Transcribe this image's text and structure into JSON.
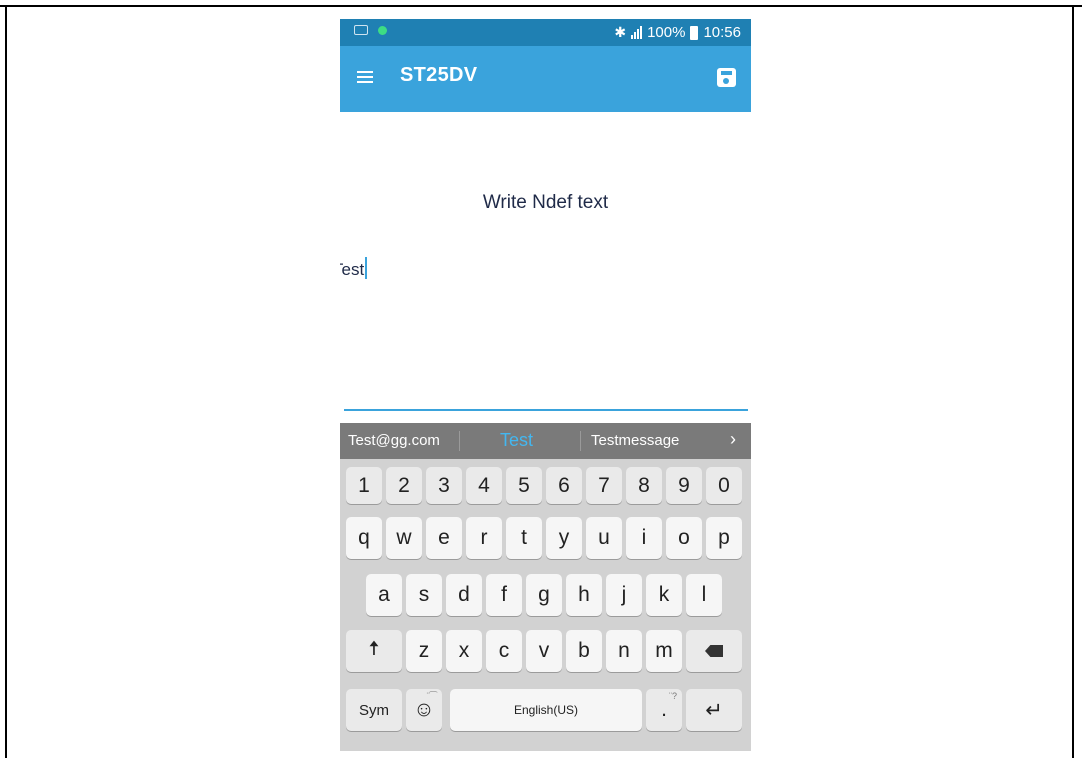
{
  "status_bar": {
    "battery": "100%",
    "time": "10:56",
    "icons": [
      "keyboard-icon",
      "dot-icon",
      "bluetooth-icon",
      "signal-icon",
      "battery-icon"
    ]
  },
  "app_bar": {
    "title": "ST25DV",
    "icons": [
      "menu-icon",
      "save-icon"
    ]
  },
  "content": {
    "heading": "Write Ndef text",
    "text_value": "Test"
  },
  "suggestions": {
    "left": "Test@gg.com",
    "middle": "Test",
    "right": "Testmessage",
    "more": "›"
  },
  "keyboard": {
    "row_numbers": [
      "1",
      "2",
      "3",
      "4",
      "5",
      "6",
      "7",
      "8",
      "9",
      "0"
    ],
    "row_1": [
      "q",
      "w",
      "e",
      "r",
      "t",
      "y",
      "u",
      "i",
      "o",
      "p"
    ],
    "row_2": [
      "a",
      "s",
      "d",
      "f",
      "g",
      "h",
      "j",
      "k",
      "l"
    ],
    "row_3": [
      "z",
      "x",
      "c",
      "v",
      "b",
      "n",
      "m"
    ],
    "sym_label": "Sym",
    "space_label": "English(US)",
    "period_label": ".",
    "period_hint": "¨?",
    "emoji_hint": "¨⁀",
    "shift_glyph": "🠅",
    "enter_glyph": "↵",
    "emoji_glyph": "☺"
  },
  "colors": {
    "status_bar": "#1f80b3",
    "app_bar": "#3aa3dc",
    "accent": "#3aa3dc",
    "suggestion_bar": "#7a7a7a",
    "keyboard_bg": "#d2d2d2"
  }
}
